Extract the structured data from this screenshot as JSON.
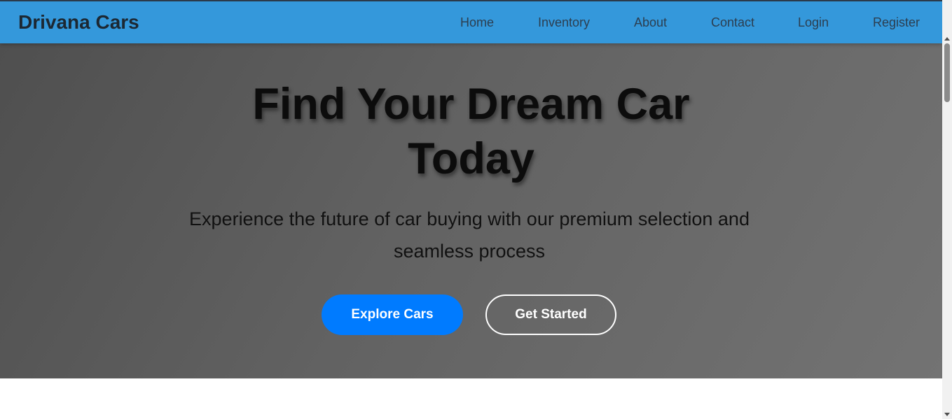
{
  "nav": {
    "brand": "Drivana Cars",
    "links": [
      "Home",
      "Inventory",
      "About",
      "Contact",
      "Login",
      "Register"
    ]
  },
  "hero": {
    "title_line1": "Find Your Dream Car",
    "title_line2": "Today",
    "subtitle": "Experience the future of car buying with our premium selection and seamless process",
    "primary_button": "Explore Cars",
    "secondary_button": "Get Started"
  },
  "colors": {
    "nav_bg": "#3498db",
    "primary_button": "#007bff",
    "hero_bg": "#626262"
  },
  "icons": {
    "scroll_up": "triangle-up",
    "scroll_down": "triangle-down"
  }
}
